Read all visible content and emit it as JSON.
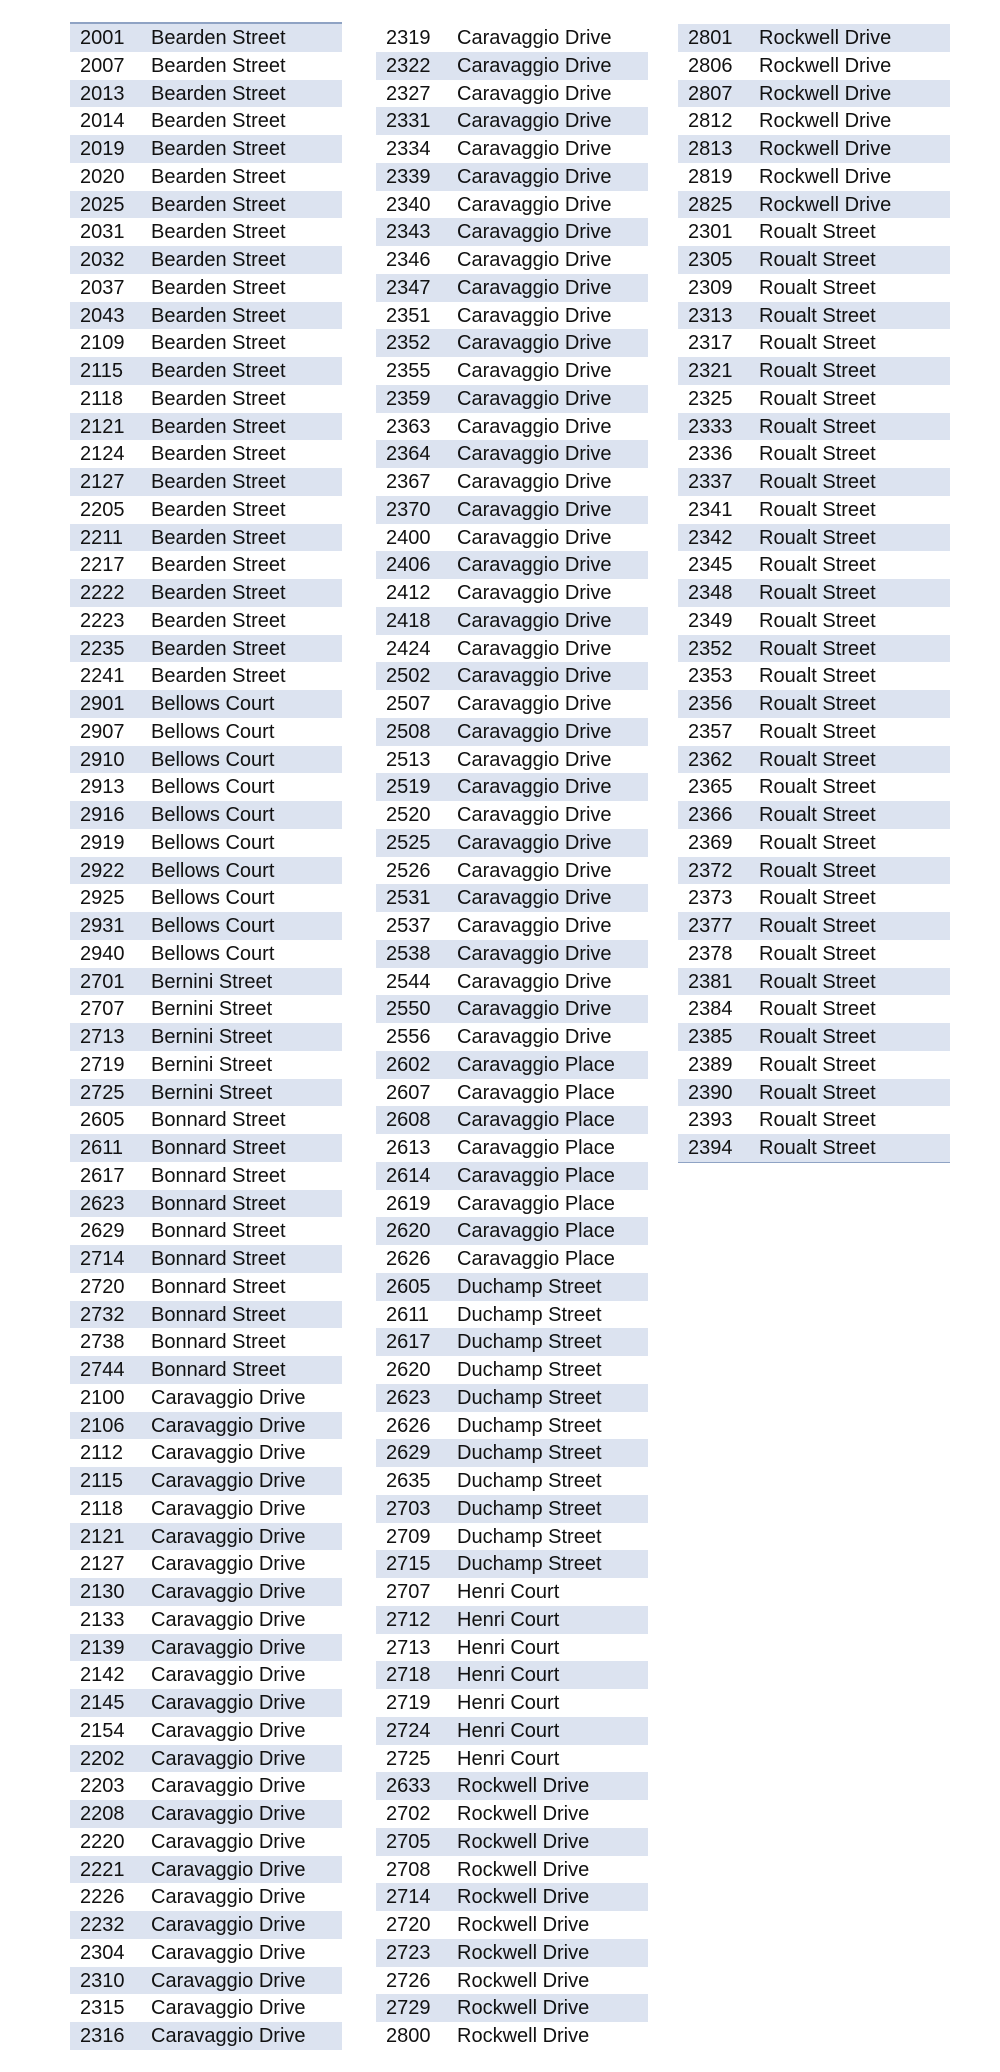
{
  "colors": {
    "stripe": "#dce3f0",
    "rule": "#8fa3c4"
  },
  "columns": [
    {
      "first_row_shaded": true,
      "rows": [
        [
          "2001",
          "Bearden Street"
        ],
        [
          "2007",
          "Bearden Street"
        ],
        [
          "2013",
          "Bearden Street"
        ],
        [
          "2014",
          "Bearden Street"
        ],
        [
          "2019",
          "Bearden Street"
        ],
        [
          "2020",
          "Bearden Street"
        ],
        [
          "2025",
          "Bearden Street"
        ],
        [
          "2031",
          "Bearden Street"
        ],
        [
          "2032",
          "Bearden Street"
        ],
        [
          "2037",
          "Bearden Street"
        ],
        [
          "2043",
          "Bearden Street"
        ],
        [
          "2109",
          "Bearden Street"
        ],
        [
          "2115",
          "Bearden Street"
        ],
        [
          "2118",
          "Bearden Street"
        ],
        [
          "2121",
          "Bearden Street"
        ],
        [
          "2124",
          "Bearden Street"
        ],
        [
          "2127",
          "Bearden Street"
        ],
        [
          "2205",
          "Bearden Street"
        ],
        [
          "2211",
          "Bearden Street"
        ],
        [
          "2217",
          "Bearden Street"
        ],
        [
          "2222",
          "Bearden Street"
        ],
        [
          "2223",
          "Bearden Street"
        ],
        [
          "2235",
          "Bearden Street"
        ],
        [
          "2241",
          "Bearden Street"
        ],
        [
          "2901",
          "Bellows Court"
        ],
        [
          "2907",
          "Bellows Court"
        ],
        [
          "2910",
          "Bellows Court"
        ],
        [
          "2913",
          "Bellows Court"
        ],
        [
          "2916",
          "Bellows Court"
        ],
        [
          "2919",
          "Bellows Court"
        ],
        [
          "2922",
          "Bellows Court"
        ],
        [
          "2925",
          "Bellows Court"
        ],
        [
          "2931",
          "Bellows Court"
        ],
        [
          "2940",
          "Bellows Court"
        ],
        [
          "2701",
          "Bernini Street"
        ],
        [
          "2707",
          "Bernini Street"
        ],
        [
          "2713",
          "Bernini Street"
        ],
        [
          "2719",
          "Bernini Street"
        ],
        [
          "2725",
          "Bernini Street"
        ],
        [
          "2605",
          "Bonnard Street"
        ],
        [
          "2611",
          "Bonnard Street"
        ],
        [
          "2617",
          "Bonnard Street"
        ],
        [
          "2623",
          "Bonnard Street"
        ],
        [
          "2629",
          "Bonnard Street"
        ],
        [
          "2714",
          "Bonnard Street"
        ],
        [
          "2720",
          "Bonnard Street"
        ],
        [
          "2732",
          "Bonnard Street"
        ],
        [
          "2738",
          "Bonnard Street"
        ],
        [
          "2744",
          "Bonnard Street"
        ],
        [
          "2100",
          "Caravaggio Drive"
        ],
        [
          "2106",
          "Caravaggio Drive"
        ],
        [
          "2112",
          "Caravaggio Drive"
        ],
        [
          "2115",
          "Caravaggio Drive"
        ],
        [
          "2118",
          "Caravaggio Drive"
        ],
        [
          "2121",
          "Caravaggio Drive"
        ],
        [
          "2127",
          "Caravaggio Drive"
        ],
        [
          "2130",
          "Caravaggio Drive"
        ],
        [
          "2133",
          "Caravaggio Drive"
        ],
        [
          "2139",
          "Caravaggio Drive"
        ],
        [
          "2142",
          "Caravaggio Drive"
        ],
        [
          "2145",
          "Caravaggio Drive"
        ],
        [
          "2154",
          "Caravaggio Drive"
        ],
        [
          "2202",
          "Caravaggio Drive"
        ],
        [
          "2203",
          "Caravaggio Drive"
        ],
        [
          "2208",
          "Caravaggio Drive"
        ],
        [
          "2220",
          "Caravaggio Drive"
        ],
        [
          "2221",
          "Caravaggio Drive"
        ],
        [
          "2226",
          "Caravaggio Drive"
        ],
        [
          "2232",
          "Caravaggio Drive"
        ],
        [
          "2304",
          "Caravaggio Drive"
        ],
        [
          "2310",
          "Caravaggio Drive"
        ],
        [
          "2315",
          "Caravaggio Drive"
        ],
        [
          "2316",
          "Caravaggio Drive"
        ]
      ]
    },
    {
      "first_row_shaded": false,
      "rows": [
        [
          "2319",
          "Caravaggio Drive"
        ],
        [
          "2322",
          "Caravaggio Drive"
        ],
        [
          "2327",
          "Caravaggio Drive"
        ],
        [
          "2331",
          "Caravaggio Drive"
        ],
        [
          "2334",
          "Caravaggio Drive"
        ],
        [
          "2339",
          "Caravaggio Drive"
        ],
        [
          "2340",
          "Caravaggio Drive"
        ],
        [
          "2343",
          "Caravaggio Drive"
        ],
        [
          "2346",
          "Caravaggio Drive"
        ],
        [
          "2347",
          "Caravaggio Drive"
        ],
        [
          "2351",
          "Caravaggio Drive"
        ],
        [
          "2352",
          "Caravaggio Drive"
        ],
        [
          "2355",
          "Caravaggio Drive"
        ],
        [
          "2359",
          "Caravaggio Drive"
        ],
        [
          "2363",
          "Caravaggio Drive"
        ],
        [
          "2364",
          "Caravaggio Drive"
        ],
        [
          "2367",
          "Caravaggio Drive"
        ],
        [
          "2370",
          "Caravaggio Drive"
        ],
        [
          "2400",
          "Caravaggio Drive"
        ],
        [
          "2406",
          "Caravaggio Drive"
        ],
        [
          "2412",
          "Caravaggio Drive"
        ],
        [
          "2418",
          "Caravaggio Drive"
        ],
        [
          "2424",
          "Caravaggio Drive"
        ],
        [
          "2502",
          "Caravaggio Drive"
        ],
        [
          "2507",
          "Caravaggio Drive"
        ],
        [
          "2508",
          "Caravaggio Drive"
        ],
        [
          "2513",
          "Caravaggio Drive"
        ],
        [
          "2519",
          "Caravaggio Drive"
        ],
        [
          "2520",
          "Caravaggio Drive"
        ],
        [
          "2525",
          "Caravaggio Drive"
        ],
        [
          "2526",
          "Caravaggio Drive"
        ],
        [
          "2531",
          "Caravaggio Drive"
        ],
        [
          "2537",
          "Caravaggio Drive"
        ],
        [
          "2538",
          "Caravaggio Drive"
        ],
        [
          "2544",
          "Caravaggio Drive"
        ],
        [
          "2550",
          "Caravaggio Drive"
        ],
        [
          "2556",
          "Caravaggio Drive"
        ],
        [
          "2602",
          "Caravaggio Place"
        ],
        [
          "2607",
          "Caravaggio Place"
        ],
        [
          "2608",
          "Caravaggio Place"
        ],
        [
          "2613",
          "Caravaggio Place"
        ],
        [
          "2614",
          "Caravaggio Place"
        ],
        [
          "2619",
          "Caravaggio Place"
        ],
        [
          "2620",
          "Caravaggio Place"
        ],
        [
          "2626",
          "Caravaggio Place"
        ],
        [
          "2605",
          "Duchamp Street"
        ],
        [
          "2611",
          "Duchamp Street"
        ],
        [
          "2617",
          "Duchamp Street"
        ],
        [
          "2620",
          "Duchamp Street"
        ],
        [
          "2623",
          "Duchamp Street"
        ],
        [
          "2626",
          "Duchamp Street"
        ],
        [
          "2629",
          "Duchamp Street"
        ],
        [
          "2635",
          "Duchamp Street"
        ],
        [
          "2703",
          "Duchamp Street"
        ],
        [
          "2709",
          "Duchamp Street"
        ],
        [
          "2715",
          "Duchamp Street"
        ],
        [
          "2707",
          "Henri Court"
        ],
        [
          "2712",
          "Henri Court"
        ],
        [
          "2713",
          "Henri Court"
        ],
        [
          "2718",
          "Henri Court"
        ],
        [
          "2719",
          "Henri Court"
        ],
        [
          "2724",
          "Henri Court"
        ],
        [
          "2725",
          "Henri Court"
        ],
        [
          "2633",
          "Rockwell Drive"
        ],
        [
          "2702",
          "Rockwell Drive"
        ],
        [
          "2705",
          "Rockwell Drive"
        ],
        [
          "2708",
          "Rockwell Drive"
        ],
        [
          "2714",
          "Rockwell Drive"
        ],
        [
          "2720",
          "Rockwell Drive"
        ],
        [
          "2723",
          "Rockwell Drive"
        ],
        [
          "2726",
          "Rockwell Drive"
        ],
        [
          "2729",
          "Rockwell Drive"
        ],
        [
          "2800",
          "Rockwell Drive"
        ]
      ]
    },
    {
      "first_row_shaded": true,
      "rows": [
        [
          "2801",
          "Rockwell Drive"
        ],
        [
          "2806",
          "Rockwell Drive"
        ],
        [
          "2807",
          "Rockwell Drive"
        ],
        [
          "2812",
          "Rockwell Drive"
        ],
        [
          "2813",
          "Rockwell Drive"
        ],
        [
          "2819",
          "Rockwell Drive"
        ],
        [
          "2825",
          "Rockwell Drive"
        ],
        [
          "2301",
          "Roualt Street"
        ],
        [
          "2305",
          "Roualt Street"
        ],
        [
          "2309",
          "Roualt Street"
        ],
        [
          "2313",
          "Roualt Street"
        ],
        [
          "2317",
          "Roualt Street"
        ],
        [
          "2321",
          "Roualt Street"
        ],
        [
          "2325",
          "Roualt Street"
        ],
        [
          "2333",
          "Roualt Street"
        ],
        [
          "2336",
          "Roualt Street"
        ],
        [
          "2337",
          "Roualt Street"
        ],
        [
          "2341",
          "Roualt Street"
        ],
        [
          "2342",
          "Roualt Street"
        ],
        [
          "2345",
          "Roualt Street"
        ],
        [
          "2348",
          "Roualt Street"
        ],
        [
          "2349",
          "Roualt Street"
        ],
        [
          "2352",
          "Roualt Street"
        ],
        [
          "2353",
          "Roualt Street"
        ],
        [
          "2356",
          "Roualt Street"
        ],
        [
          "2357",
          "Roualt Street"
        ],
        [
          "2362",
          "Roualt Street"
        ],
        [
          "2365",
          "Roualt Street"
        ],
        [
          "2366",
          "Roualt Street"
        ],
        [
          "2369",
          "Roualt Street"
        ],
        [
          "2372",
          "Roualt Street"
        ],
        [
          "2373",
          "Roualt Street"
        ],
        [
          "2377",
          "Roualt Street"
        ],
        [
          "2378",
          "Roualt Street"
        ],
        [
          "2381",
          "Roualt Street"
        ],
        [
          "2384",
          "Roualt Street"
        ],
        [
          "2385",
          "Roualt Street"
        ],
        [
          "2389",
          "Roualt Street"
        ],
        [
          "2390",
          "Roualt Street"
        ],
        [
          "2393",
          "Roualt Street"
        ],
        [
          "2394",
          "Roualt Street"
        ]
      ]
    }
  ]
}
